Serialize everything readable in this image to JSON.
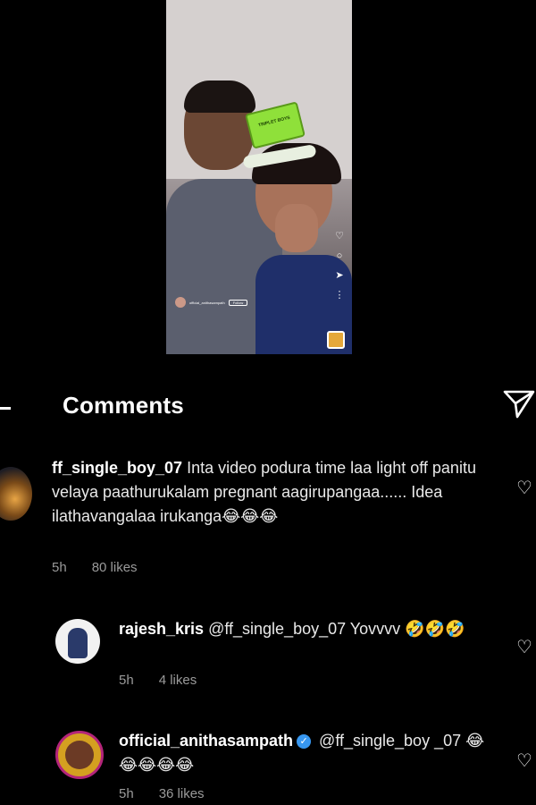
{
  "video": {
    "filter_label": "TRIPLET BOYS",
    "account": "official_anithasampath",
    "follow_label": "Follow",
    "side_icons": [
      "heart-icon",
      "comment-icon",
      "send-icon",
      "more-icon"
    ]
  },
  "header": {
    "title": "Comments"
  },
  "comments": [
    {
      "username": "ff_single_boy_07",
      "text": " Inta video podura time laa light off panitu velaya paathurukalam pregnant aagirupangaa...... Idea ilathavangalaa irukanga😂😂😂",
      "time": "5h",
      "likes": "80 likes",
      "verified": false
    },
    {
      "username": "rajesh_kris",
      "text": " @ff_single_boy_07 Yovvvv 🤣🤣🤣",
      "time": "5h",
      "likes": "4 likes",
      "verified": false
    },
    {
      "username": "official_anithasampath",
      "verified_mark": "✓",
      "text": " @ff_single_boy _07 😂😂😂😂😂",
      "time": "5h",
      "likes": "36 likes",
      "verified": true
    }
  ],
  "colors": {
    "background": "#000000",
    "text": "#e9e9e9",
    "meta": "#9a9a9a",
    "verified": "#3797f0"
  }
}
